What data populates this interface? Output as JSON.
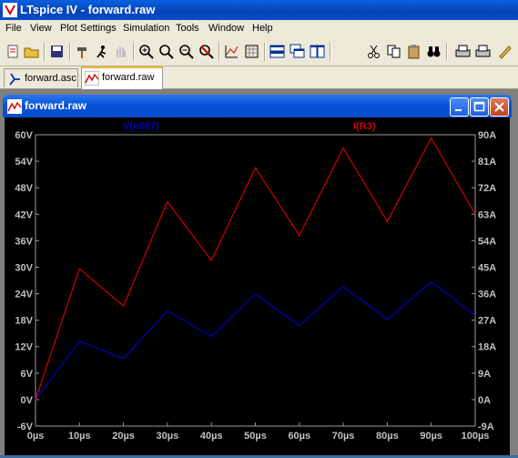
{
  "app": {
    "title": "LTspice IV - forward.raw"
  },
  "menu": [
    "File",
    "View",
    "Plot Settings",
    "Simulation",
    "Tools",
    "Window",
    "Help"
  ],
  "tabs": [
    {
      "label": "forward.asc",
      "active": false
    },
    {
      "label": "forward.raw",
      "active": true
    }
  ],
  "plot_window": {
    "title": "forward.raw"
  },
  "colors": {
    "trace_v": "#0000c0",
    "trace_i": "#d00000",
    "plot_bg": "#000000",
    "axis_text": "#c0c0c0"
  },
  "chart_data": {
    "type": "line",
    "x_unit": "µs",
    "x_ticks": [
      "0µs",
      "10µs",
      "20µs",
      "30µs",
      "40µs",
      "50µs",
      "60µs",
      "70µs",
      "80µs",
      "90µs",
      "100µs"
    ],
    "xlim": [
      0,
      100
    ],
    "y_left_ticks": [
      "60V",
      "54V",
      "48V",
      "42V",
      "36V",
      "30V",
      "24V",
      "18V",
      "12V",
      "6V",
      "0V",
      "-6V"
    ],
    "ylim_left": [
      -6,
      60
    ],
    "y_right_ticks": [
      "90A",
      "81A",
      "72A",
      "63A",
      "54A",
      "45A",
      "36A",
      "27A",
      "18A",
      "9A",
      "0A",
      "-9A"
    ],
    "ylim_right": [
      -9,
      90
    ],
    "grid": false,
    "series": [
      {
        "name": "V(n007)",
        "axis": "left",
        "x": [
          0,
          10,
          20,
          30,
          40,
          50,
          60,
          70,
          80,
          90,
          100
        ],
        "y": [
          0,
          13.2,
          9.3,
          20.1,
          14.3,
          23.9,
          16.8,
          25.6,
          18.2,
          26.7,
          19.0
        ]
      },
      {
        "name": "I(R3)",
        "axis": "right",
        "x": [
          0,
          10,
          20,
          30,
          40,
          50,
          60,
          70,
          80,
          90,
          100
        ],
        "y": [
          0,
          44.5,
          31.8,
          67.3,
          47.3,
          78.8,
          55.8,
          85.5,
          60.5,
          88.9,
          63.0
        ]
      }
    ]
  }
}
